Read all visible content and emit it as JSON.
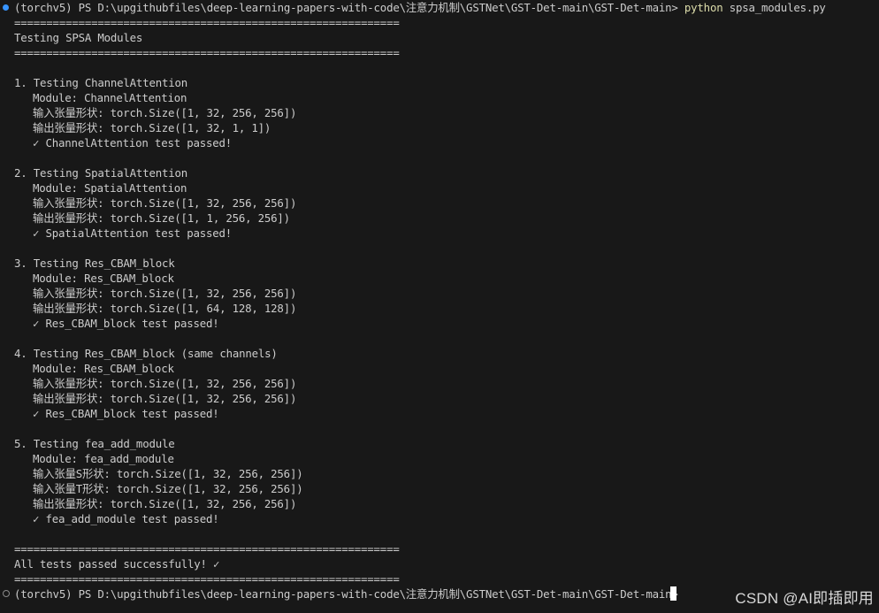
{
  "prompt_first": {
    "path": "(torchv5) PS D:\\upgithubfiles\\deep-learning-papers-with-code\\注意力机制\\GSTNet\\GST-Det-main\\GST-Det-main> ",
    "command": "python",
    "argument": " spsa_modules.py"
  },
  "separator": "============================================================",
  "header_title": "Testing SPSA Modules",
  "tests": [
    {
      "title": "1. Testing ChannelAttention",
      "module": "Module: ChannelAttention",
      "lines": [
        "输入张量形状: torch.Size([1, 32, 256, 256])",
        "输出张量形状: torch.Size([1, 32, 1, 1])"
      ],
      "result": "✓ ChannelAttention test passed!"
    },
    {
      "title": "2. Testing SpatialAttention",
      "module": "Module: SpatialAttention",
      "lines": [
        "输入张量形状: torch.Size([1, 32, 256, 256])",
        "输出张量形状: torch.Size([1, 1, 256, 256])"
      ],
      "result": "✓ SpatialAttention test passed!"
    },
    {
      "title": "3. Testing Res_CBAM_block",
      "module": "Module: Res_CBAM_block",
      "lines": [
        "输入张量形状: torch.Size([1, 32, 256, 256])",
        "输出张量形状: torch.Size([1, 64, 128, 128])"
      ],
      "result": "✓ Res_CBAM_block test passed!"
    },
    {
      "title": "4. Testing Res_CBAM_block (same channels)",
      "module": "Module: Res_CBAM_block",
      "lines": [
        "输入张量形状: torch.Size([1, 32, 256, 256])",
        "输出张量形状: torch.Size([1, 32, 256, 256])"
      ],
      "result": "✓ Res_CBAM_block test passed!"
    },
    {
      "title": "5. Testing fea_add_module",
      "module": "Module: fea_add_module",
      "lines": [
        "输入张量S形状: torch.Size([1, 32, 256, 256])",
        "输入张量T形状: torch.Size([1, 32, 256, 256])",
        "输出张量形状: torch.Size([1, 32, 256, 256])"
      ],
      "result": "✓ fea_add_module test passed!"
    }
  ],
  "footer_message": "All tests passed successfully! ✓",
  "prompt_last": {
    "path": "(torchv5) PS D:\\upgithubfiles\\deep-learning-papers-with-code\\注意力机制\\GSTNet\\GST-Det-main\\GST-Det-main> "
  },
  "watermark": "CSDN @AI即插即用",
  "colors": {
    "background": "#181818",
    "text": "#cccccc",
    "command": "#dcdcaa",
    "prompt_dot_active": "#3794ff"
  }
}
